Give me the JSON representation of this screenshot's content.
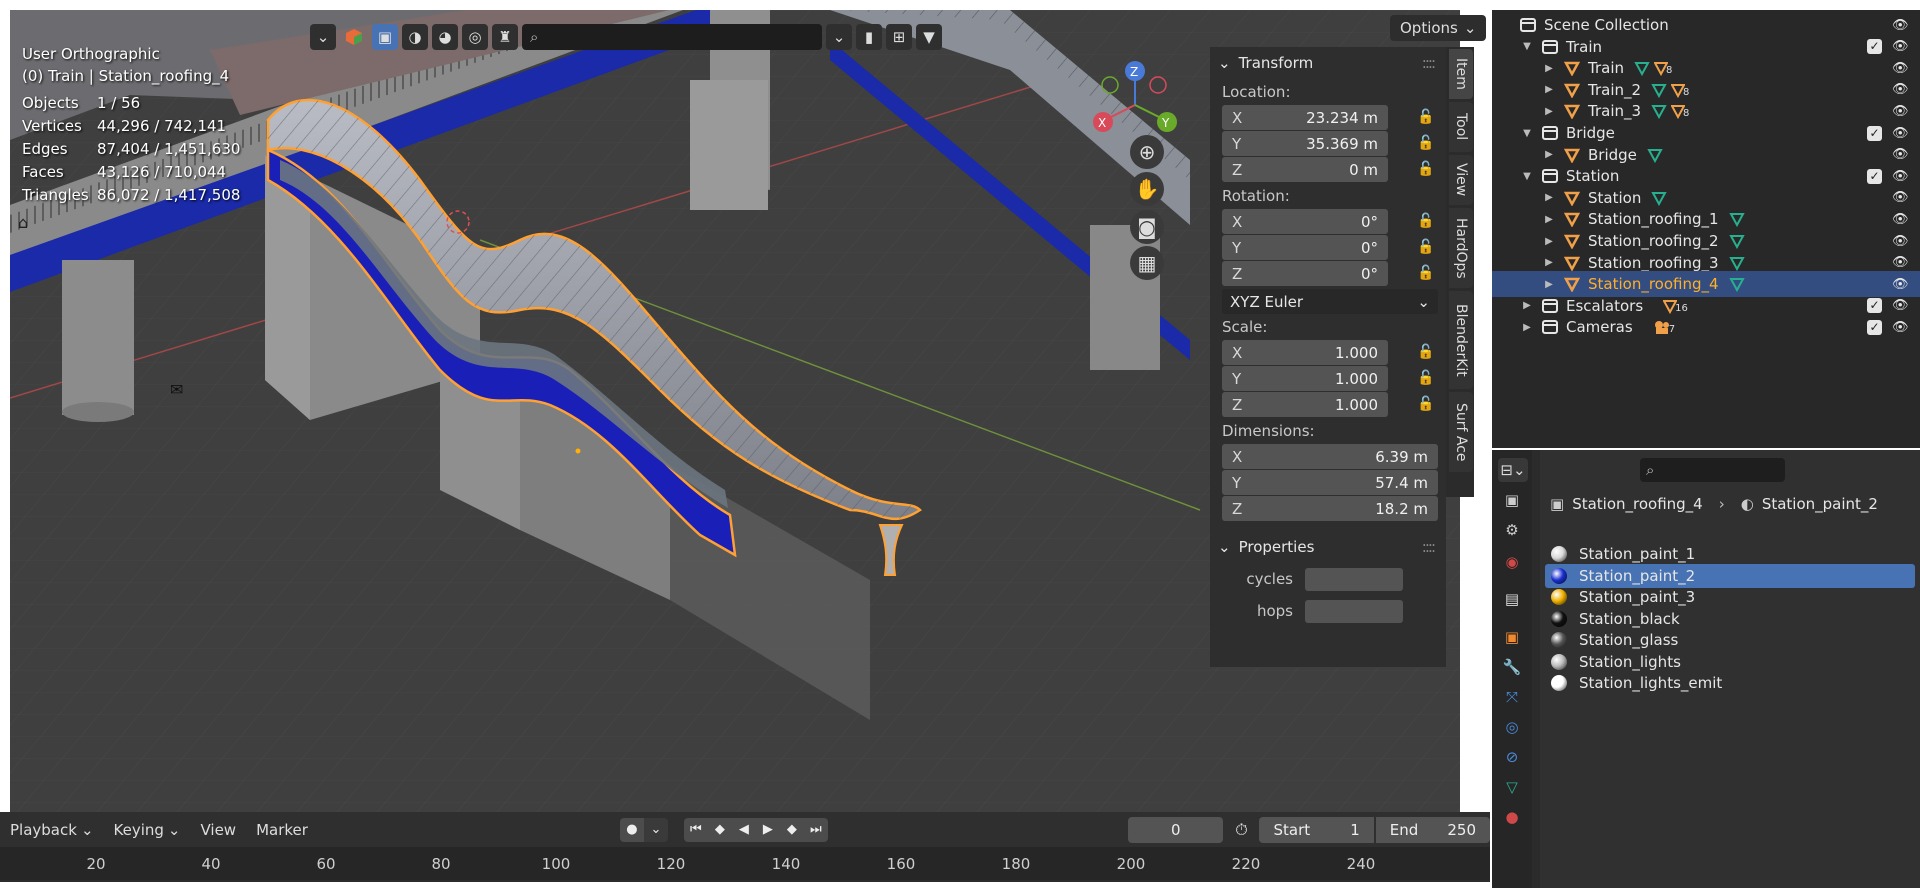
{
  "colors": {
    "selection_outline": "#ffa033",
    "active_material": "#4772b3",
    "vertex_group_green": "#27b08f",
    "object_orange": "#f0a048",
    "outliner_selected": "#334d80"
  },
  "viewport": {
    "view_name": "User Orthographic",
    "context": "(0) Train | Station_roofing_4",
    "stats": [
      {
        "label": "Objects",
        "value": "1 / 56"
      },
      {
        "label": "Vertices",
        "value": "44,296 / 742,141"
      },
      {
        "label": "Edges",
        "value": "87,404 / 1,451,630"
      },
      {
        "label": "Faces",
        "value": "43,126 / 710,044"
      },
      {
        "label": "Triangles",
        "value": "86,072 / 1,417,508"
      }
    ],
    "options_label": "Options",
    "gizmo_axes": [
      "X",
      "Y",
      "Z"
    ]
  },
  "npanel": {
    "transform_title": "Transform",
    "location_label": "Location:",
    "location": [
      {
        "axis": "X",
        "value": "23.234 m"
      },
      {
        "axis": "Y",
        "value": "35.369 m"
      },
      {
        "axis": "Z",
        "value": "0 m"
      }
    ],
    "rotation_label": "Rotation:",
    "rotation": [
      {
        "axis": "X",
        "value": "0°"
      },
      {
        "axis": "Y",
        "value": "0°"
      },
      {
        "axis": "Z",
        "value": "0°"
      }
    ],
    "rotation_mode": "XYZ Euler",
    "scale_label": "Scale:",
    "scale": [
      {
        "axis": "X",
        "value": "1.000"
      },
      {
        "axis": "Y",
        "value": "1.000"
      },
      {
        "axis": "Z",
        "value": "1.000"
      }
    ],
    "dimensions_label": "Dimensions:",
    "dimensions": [
      {
        "axis": "X",
        "value": "6.39 m"
      },
      {
        "axis": "Y",
        "value": "57.4 m"
      },
      {
        "axis": "Z",
        "value": "18.2 m"
      }
    ],
    "properties_title": "Properties",
    "custom_props": [
      "cycles",
      "hops"
    ],
    "tabs": [
      "Item",
      "Tool",
      "View",
      "HardOps",
      "BlenderKit",
      "Surf Ace"
    ]
  },
  "timeline": {
    "menus": [
      "Playback",
      "Keying",
      "View",
      "Marker"
    ],
    "current_frame": "0",
    "start_label": "Start",
    "start_value": "1",
    "end_label": "End",
    "end_value": "250",
    "ticks": [
      "20",
      "40",
      "60",
      "80",
      "100",
      "120",
      "140",
      "160",
      "180",
      "200",
      "220",
      "240"
    ]
  },
  "outliner": {
    "rows": [
      {
        "label": "Scene Collection",
        "type": "scene",
        "indent": 0
      },
      {
        "label": "Train",
        "type": "collection",
        "indent": 1,
        "check": true
      },
      {
        "label": "Train",
        "type": "object",
        "indent": 2,
        "count": "8"
      },
      {
        "label": "Train_2",
        "type": "object",
        "indent": 2,
        "count": "8"
      },
      {
        "label": "Train_3",
        "type": "object",
        "indent": 2,
        "count": "8"
      },
      {
        "label": "Bridge",
        "type": "collection",
        "indent": 1,
        "check": true
      },
      {
        "label": "Bridge",
        "type": "object",
        "indent": 2
      },
      {
        "label": "Station",
        "type": "collection",
        "indent": 1,
        "check": true
      },
      {
        "label": "Station",
        "type": "object",
        "indent": 2
      },
      {
        "label": "Station_roofing_1",
        "type": "object",
        "indent": 2
      },
      {
        "label": "Station_roofing_2",
        "type": "object",
        "indent": 2
      },
      {
        "label": "Station_roofing_3",
        "type": "object",
        "indent": 2
      },
      {
        "label": "Station_roofing_4",
        "type": "object",
        "indent": 2,
        "selected": true
      },
      {
        "label": "Escalators",
        "type": "collection",
        "indent": 1,
        "check": true,
        "count": "16"
      },
      {
        "label": "Cameras",
        "type": "collection",
        "indent": 1,
        "check": true,
        "count": "7"
      }
    ]
  },
  "properties": {
    "breadcrumb_object": "Station_roofing_4",
    "breadcrumb_material": "Station_paint_2",
    "materials": [
      {
        "name": "Station_paint_1",
        "color": "#d8d8d8"
      },
      {
        "name": "Station_paint_2",
        "color": "#1a2fd0",
        "selected": true
      },
      {
        "name": "Station_paint_3",
        "color": "#f0b000"
      },
      {
        "name": "Station_black",
        "color": "#111111"
      },
      {
        "name": "Station_glass",
        "color": "#555555"
      },
      {
        "name": "Station_lights",
        "color": "#bbbbbb"
      },
      {
        "name": "Station_lights_emit",
        "color": "#ffffff"
      }
    ]
  }
}
